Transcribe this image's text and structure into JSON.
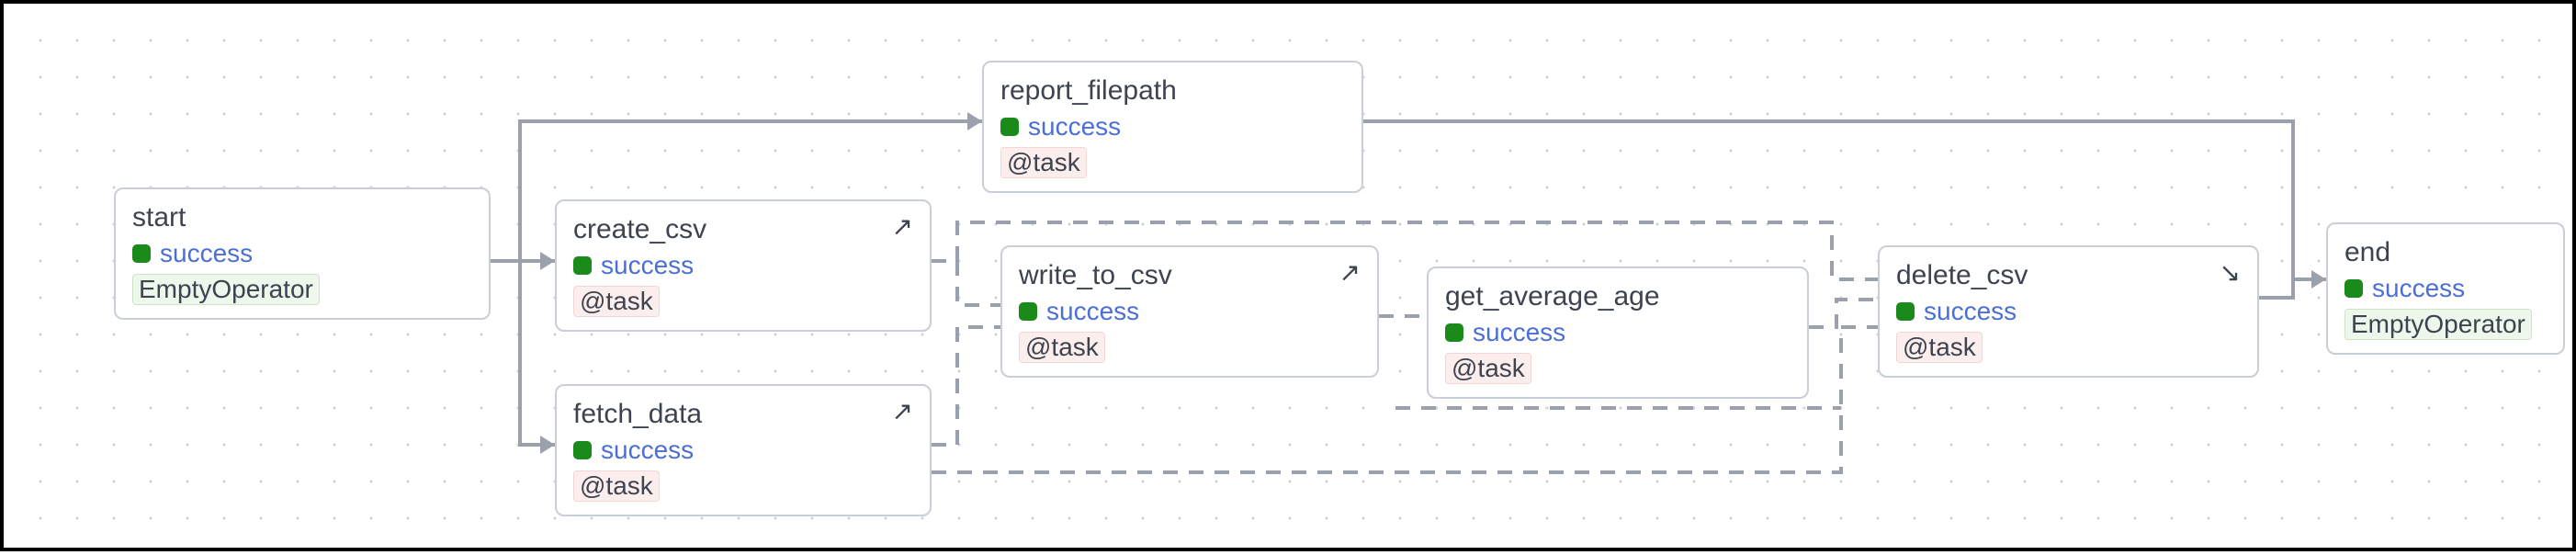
{
  "graph": {
    "nodes": {
      "start": {
        "title": "start",
        "status": "success",
        "operator": "EmptyOperator",
        "op_class": "op-empty",
        "icon": null
      },
      "create_csv": {
        "title": "create_csv",
        "status": "success",
        "operator": "@task",
        "op_class": "op-task",
        "icon": "↗"
      },
      "fetch_data": {
        "title": "fetch_data",
        "status": "success",
        "operator": "@task",
        "op_class": "op-task",
        "icon": "↗"
      },
      "report_filepath": {
        "title": "report_filepath",
        "status": "success",
        "operator": "@task",
        "op_class": "op-task",
        "icon": null
      },
      "write_to_csv": {
        "title": "write_to_csv",
        "status": "success",
        "operator": "@task",
        "op_class": "op-task",
        "icon": "↗"
      },
      "get_average_age": {
        "title": "get_average_age",
        "status": "success",
        "operator": "@task",
        "op_class": "op-task",
        "icon": null
      },
      "delete_csv": {
        "title": "delete_csv",
        "status": "success",
        "operator": "@task",
        "op_class": "op-task",
        "icon": "↘"
      },
      "end": {
        "title": "end",
        "status": "success",
        "operator": "EmptyOperator",
        "op_class": "op-empty",
        "icon": null
      }
    }
  }
}
